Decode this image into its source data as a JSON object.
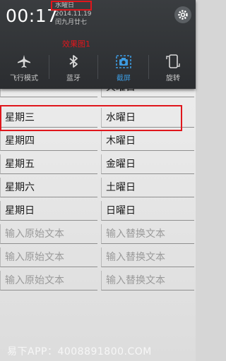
{
  "status": {
    "time": "00:17",
    "weekday": "水曜日",
    "date": "2014.11.19",
    "lunar": "闰九月廿七"
  },
  "caption": "效果图1",
  "toggles": [
    {
      "label": "飞行模式",
      "icon": "airplane-icon"
    },
    {
      "label": "蓝牙",
      "icon": "bluetooth-icon"
    },
    {
      "label": "截屏",
      "icon": "screenshot-icon",
      "active": true
    },
    {
      "label": "旋转",
      "icon": "rotate-icon"
    }
  ],
  "list": {
    "partial_right": "火曜日",
    "rows": [
      {
        "left": "星期三",
        "right": "水曜日"
      },
      {
        "left": "星期四",
        "right": "木曜日"
      },
      {
        "left": "星期五",
        "right": "金曜日"
      },
      {
        "left": "星期六",
        "right": "土曜日"
      },
      {
        "left": "星期日",
        "right": "日曜日"
      }
    ],
    "placeholder_left": "输入原始文本",
    "placeholder_right": "输入替换文本"
  },
  "watermark": "易下APP：4008891800.COM",
  "colors": {
    "highlight": "#e0161c",
    "accent": "#3d9be0"
  }
}
